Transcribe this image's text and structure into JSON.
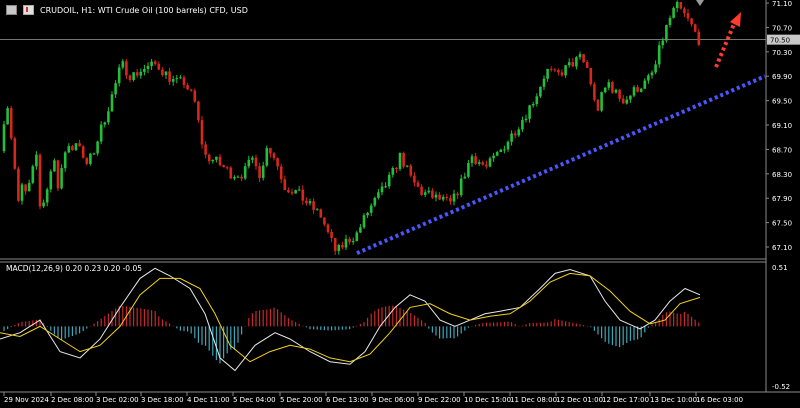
{
  "header": {
    "title": "CRUDOIL, H1:  WTI Crude Oil (100 barrels) CFD, USD"
  },
  "macd": {
    "label": "MACD(12,26,9) 0.20 0.23 0.20 -0.05",
    "axis_top": "0.51",
    "axis_bottom": "-0.52"
  },
  "colors": {
    "background": "#000000",
    "bull": "#22c03a",
    "bear": "#d8261c",
    "trendline": "#4a57ff",
    "arrow": "#ff3b30",
    "macd_line": "#e8e8e8",
    "signal_line": "#f2d21a",
    "hist_pos": "#c82828",
    "hist_neg": "#3aa8b8",
    "price_label_bg": "#c8c8c8"
  },
  "chart_data": [
    {
      "type": "candlestick",
      "title": "CRUDOIL, H1:  WTI Crude Oil (100 barrels) CFD, USD",
      "ylim": [
        66.92,
        71.15
      ],
      "y_ticks": [
        "71.10",
        "70.70",
        "70.30",
        "69.90",
        "69.50",
        "69.10",
        "68.70",
        "68.30",
        "67.90",
        "67.50",
        "67.10"
      ],
      "current_price": "70.50",
      "x_labels": [
        "29 Nov 2024",
        "2 Dec 08:00",
        "3 Dec 02:00",
        "3 Dec 18:00",
        "4 Dec 11:00",
        "5 Dec 04:00",
        "5 Dec 20:00",
        "6 Dec 13:00",
        "9 Dec 06:00",
        "9 Dec 22:00",
        "10 Dec 15:00",
        "11 Dec 08:00",
        "12 Dec 01:00",
        "12 Dec 17:00",
        "13 Dec 10:00",
        "16 Dec 03:00"
      ],
      "price_path": [
        [
          0,
          68.1
        ],
        [
          7,
          69.1
        ],
        [
          10,
          69.6
        ],
        [
          17,
          68.6
        ],
        [
          22,
          67.8
        ],
        [
          27,
          68.2
        ],
        [
          30,
          67.9
        ],
        [
          40,
          68.6
        ],
        [
          44,
          67.7
        ],
        [
          50,
          68.0
        ],
        [
          58,
          68.6
        ],
        [
          62,
          68.0
        ],
        [
          70,
          68.8
        ],
        [
          75,
          68.7
        ],
        [
          82,
          68.9
        ],
        [
          88,
          68.4
        ],
        [
          96,
          68.6
        ],
        [
          108,
          69.2
        ],
        [
          118,
          69.7
        ],
        [
          125,
          70.1
        ],
        [
          135,
          69.9
        ],
        [
          145,
          70.0
        ],
        [
          160,
          70.1
        ],
        [
          178,
          69.8
        ],
        [
          188,
          69.8
        ],
        [
          198,
          69.5
        ],
        [
          208,
          68.6
        ],
        [
          220,
          68.5
        ],
        [
          235,
          68.3
        ],
        [
          247,
          68.3
        ],
        [
          258,
          68.6
        ],
        [
          265,
          68.2
        ],
        [
          270,
          68.8
        ],
        [
          280,
          68.5
        ],
        [
          288,
          68.1
        ],
        [
          300,
          68.0
        ],
        [
          312,
          67.8
        ],
        [
          325,
          67.6
        ],
        [
          332,
          67.3
        ],
        [
          340,
          67.0
        ],
        [
          350,
          67.2
        ],
        [
          360,
          67.3
        ],
        [
          372,
          67.7
        ],
        [
          385,
          68.0
        ],
        [
          396,
          68.3
        ],
        [
          404,
          68.6
        ],
        [
          415,
          68.2
        ],
        [
          425,
          68.0
        ],
        [
          440,
          67.9
        ],
        [
          455,
          67.8
        ],
        [
          466,
          68.2
        ],
        [
          475,
          68.6
        ],
        [
          490,
          68.4
        ],
        [
          505,
          68.7
        ],
        [
          518,
          69.0
        ],
        [
          530,
          69.3
        ],
        [
          540,
          69.6
        ],
        [
          550,
          70.0
        ],
        [
          560,
          69.9
        ],
        [
          575,
          70.1
        ],
        [
          584,
          70.2
        ],
        [
          592,
          70.0
        ],
        [
          600,
          69.3
        ],
        [
          606,
          69.6
        ],
        [
          612,
          69.8
        ],
        [
          620,
          69.6
        ],
        [
          628,
          69.5
        ],
        [
          640,
          69.7
        ],
        [
          650,
          69.8
        ],
        [
          658,
          70.0
        ],
        [
          664,
          70.4
        ],
        [
          672,
          70.8
        ],
        [
          680,
          71.05
        ],
        [
          688,
          70.9
        ],
        [
          696,
          70.7
        ],
        [
          702,
          70.5
        ]
      ],
      "trendline": {
        "x1": 357,
        "y1": 67.0,
        "x2": 765,
        "y2": 69.9
      },
      "arrow_label": "upward projection"
    },
    {
      "type": "line",
      "title": "MACD(12,26,9) 0.20 0.23 0.20 -0.05",
      "ylim": [
        -0.52,
        0.51
      ],
      "series": [
        {
          "name": "MACD",
          "values": [
            [
              0,
              -0.1
            ],
            [
              20,
              -0.05
            ],
            [
              40,
              0.05
            ],
            [
              60,
              -0.2
            ],
            [
              80,
              -0.25
            ],
            [
              100,
              -0.1
            ],
            [
              120,
              0.15
            ],
            [
              140,
              0.38
            ],
            [
              155,
              0.46
            ],
            [
              170,
              0.4
            ],
            [
              190,
              0.3
            ],
            [
              205,
              0.1
            ],
            [
              220,
              -0.25
            ],
            [
              235,
              -0.35
            ],
            [
              255,
              -0.15
            ],
            [
              275,
              -0.05
            ],
            [
              290,
              -0.1
            ],
            [
              310,
              -0.2
            ],
            [
              330,
              -0.28
            ],
            [
              350,
              -0.3
            ],
            [
              365,
              -0.2
            ],
            [
              380,
              0.0
            ],
            [
              395,
              0.15
            ],
            [
              410,
              0.25
            ],
            [
              425,
              0.2
            ],
            [
              440,
              0.05
            ],
            [
              455,
              0.0
            ],
            [
              470,
              0.05
            ],
            [
              485,
              0.1
            ],
            [
              500,
              0.12
            ],
            [
              520,
              0.15
            ],
            [
              540,
              0.3
            ],
            [
              555,
              0.42
            ],
            [
              570,
              0.45
            ],
            [
              590,
              0.4
            ],
            [
              605,
              0.2
            ],
            [
              620,
              0.05
            ],
            [
              640,
              -0.02
            ],
            [
              655,
              0.05
            ],
            [
              670,
              0.2
            ],
            [
              685,
              0.3
            ],
            [
              700,
              0.25
            ]
          ]
        },
        {
          "name": "Signal",
          "values": [
            [
              0,
              -0.05
            ],
            [
              20,
              -0.08
            ],
            [
              40,
              0.0
            ],
            [
              60,
              -0.1
            ],
            [
              80,
              -0.2
            ],
            [
              100,
              -0.15
            ],
            [
              120,
              0.0
            ],
            [
              140,
              0.25
            ],
            [
              160,
              0.38
            ],
            [
              180,
              0.38
            ],
            [
              200,
              0.3
            ],
            [
              215,
              0.1
            ],
            [
              230,
              -0.15
            ],
            [
              250,
              -0.28
            ],
            [
              270,
              -0.2
            ],
            [
              290,
              -0.15
            ],
            [
              310,
              -0.18
            ],
            [
              330,
              -0.25
            ],
            [
              350,
              -0.28
            ],
            [
              370,
              -0.22
            ],
            [
              390,
              -0.05
            ],
            [
              410,
              0.15
            ],
            [
              430,
              0.18
            ],
            [
              450,
              0.1
            ],
            [
              470,
              0.05
            ],
            [
              490,
              0.08
            ],
            [
              510,
              0.1
            ],
            [
              530,
              0.2
            ],
            [
              550,
              0.35
            ],
            [
              570,
              0.42
            ],
            [
              590,
              0.4
            ],
            [
              610,
              0.28
            ],
            [
              630,
              0.12
            ],
            [
              650,
              0.02
            ],
            [
              665,
              0.05
            ],
            [
              680,
              0.18
            ],
            [
              700,
              0.23
            ]
          ]
        }
      ]
    }
  ]
}
